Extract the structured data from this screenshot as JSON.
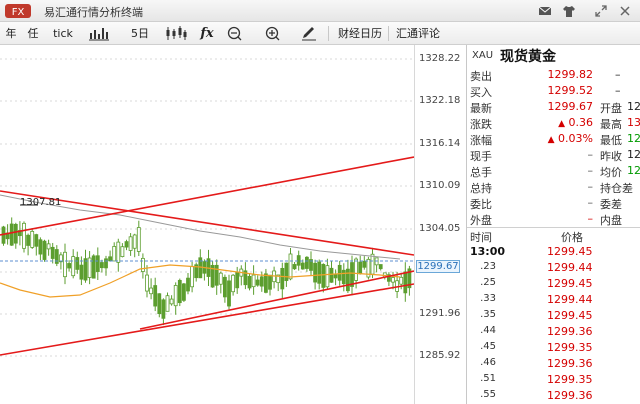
{
  "app": {
    "title": "易汇通行情分析终端"
  },
  "toolbar": {
    "items": [
      {
        "label": "年"
      },
      {
        "label": "任"
      },
      {
        "label": "tick"
      },
      {
        "label": ""
      },
      {
        "label": "5日"
      },
      {
        "label": ""
      },
      {
        "label": "fx"
      },
      {
        "label": ""
      },
      {
        "label": ""
      },
      {
        "label": ""
      },
      {
        "label": "财经日历"
      },
      {
        "label": "汇通评论"
      }
    ]
  },
  "chart": {
    "y_ticks": [
      "1328.22",
      "1322.18",
      "1316.14",
      "1310.09",
      "1304.05",
      "1291.96",
      "1285.92"
    ],
    "last_price": "1299.67",
    "high_marker": "1307.81"
  },
  "quote": {
    "symbol_code": "XAU",
    "symbol_name": "现货黄金",
    "rows": [
      {
        "label": "卖出",
        "value": "1299.82",
        "label2": "",
        "value2": "–"
      },
      {
        "label": "买入",
        "value": "1299.52",
        "label2": "",
        "value2": "–"
      },
      {
        "label": "最新",
        "value": "1299.67",
        "label2": "开盘",
        "value2": "12"
      },
      {
        "label": "涨跌",
        "value": "0.36",
        "label2": "最高",
        "value2": "13"
      },
      {
        "label": "涨幅",
        "value": "0.03%",
        "label2": "最低",
        "value2": "12"
      },
      {
        "label": "现手",
        "value": "–",
        "label2": "昨收",
        "value2": "12"
      },
      {
        "label": "总手",
        "value": "–",
        "label2": "均价",
        "value2": "12"
      },
      {
        "label": "总持",
        "value": "–",
        "label2": "持仓差",
        "value2": ""
      },
      {
        "label": "委比",
        "value": "–",
        "label2": "委差",
        "value2": ""
      },
      {
        "label": "外盘",
        "value": "–",
        "label2": "内盘",
        "value2": ""
      }
    ]
  },
  "ticks": {
    "header_time": "时间",
    "header_price": "价格",
    "rows": [
      {
        "time": "13:00",
        "price": "1299.45"
      },
      {
        "time": ".23",
        "price": "1299.44"
      },
      {
        "time": ".25",
        "price": "1299.45"
      },
      {
        "time": ".33",
        "price": "1299.44"
      },
      {
        "time": ".35",
        "price": "1299.45"
      },
      {
        "time": ".44",
        "price": "1299.36"
      },
      {
        "time": ".45",
        "price": "1299.35"
      },
      {
        "time": ".46",
        "price": "1299.36"
      },
      {
        "time": ".51",
        "price": "1299.35"
      },
      {
        "time": ".55",
        "price": "1299.36"
      }
    ]
  },
  "colors": {
    "trendline": "#e41a1a",
    "up": "#d40000",
    "down": "#009a00",
    "candle": "#5c9e2f",
    "ma_orange": "#f0a028",
    "ma_gray": "#999999",
    "last_price_line": "#5c8fd0"
  }
}
